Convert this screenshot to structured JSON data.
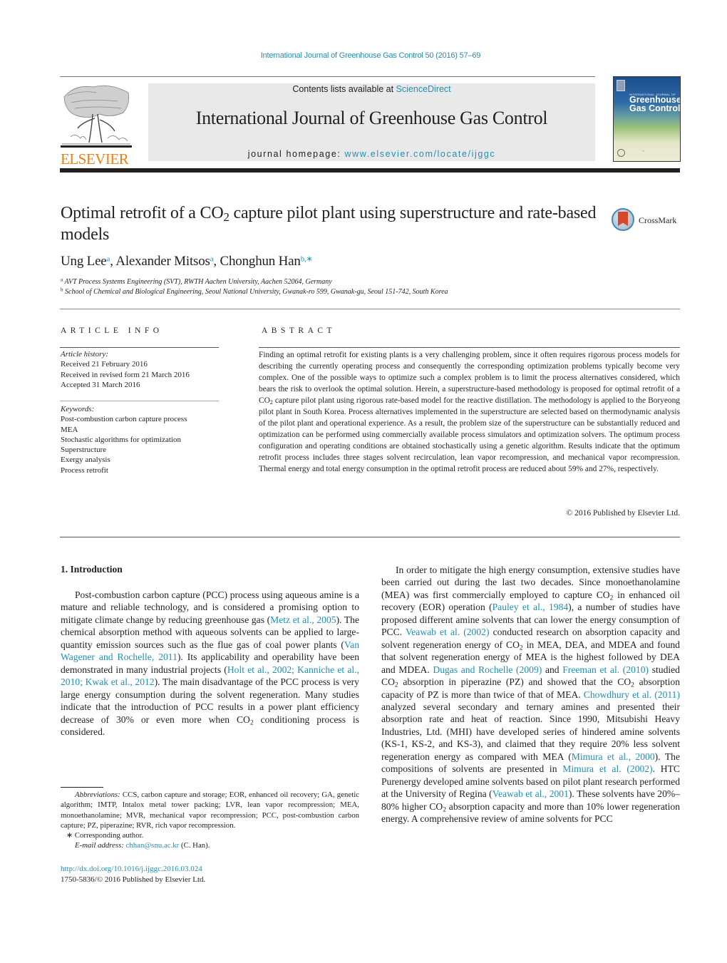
{
  "running_head": "International Journal of Greenhouse Gas Control 50 (2016) 57–69",
  "header": {
    "publisher_logo": "ELSEVIER",
    "contents_prefix": "Contents lists available at ",
    "contents_link": "ScienceDirect",
    "journal_title": "International Journal of Greenhouse Gas Control",
    "homepage_prefix": "journal homepage: ",
    "homepage_link": "www.elsevier.com/locate/ijggc",
    "cover": {
      "top_line": "INTERNATIONAL JOURNAL OF",
      "title_line1": "Greenhouse",
      "title_line2": "Gas Control"
    }
  },
  "article": {
    "title_part1": "Optimal retrofit of a CO",
    "title_sub": "2",
    "title_part2": " capture pilot plant using superstructure and rate-based models",
    "crossmark_label": "CrossMark",
    "authors": [
      {
        "name": "Ung Lee",
        "sup": "a"
      },
      {
        "name": "Alexander Mitsos",
        "sup": "a"
      },
      {
        "name": "Chonghun Han",
        "sup": "b,∗"
      }
    ],
    "affiliations": [
      {
        "key": "a",
        "text": "AVT Process Systems Engineering (SVT), RWTH Aachen University, Aachen 52064, Germany"
      },
      {
        "key": "b",
        "text": "School of Chemical and Biological Engineering, Seoul National University, Gwanak-ro 599, Gwanak-gu, Seoul 151-742, South Korea"
      }
    ]
  },
  "article_info": {
    "heading": "ARTICLE INFO",
    "history_label": "Article history:",
    "history": [
      "Received 21 February 2016",
      "Received in revised form 21 March 2016",
      "Accepted 31 March 2016"
    ],
    "keywords_label": "Keywords:",
    "keywords": [
      "Post-combustion carbon capture process",
      "MEA",
      "Stochastic algorithms for optimization",
      "Superstructure",
      "Exergy analysis",
      "Process retrofit"
    ]
  },
  "abstract": {
    "heading": "ABSTRACT",
    "text_part1": "Finding an optimal retrofit for existing plants is a very challenging problem, since it often requires rigorous process models for describing the currently operating process and consequently the corresponding optimization problems typically become very complex. One of the possible ways to optimize such a complex problem is to limit the process alternatives considered, which bears the risk to overlook the optimal solution. Herein, a superstructure-based methodology is proposed for optimal retrofit of a CO",
    "text_sub": "2",
    "text_part2": " capture pilot plant using rigorous rate-based model for the reactive distillation. The methodology is applied to the Boryeong pilot plant in South Korea. Process alternatives implemented in the superstructure are selected based on thermodynamic analysis of the pilot plant and operational experience. As a result, the problem size of the superstructure can be substantially reduced and optimization can be performed using commercially available process simulators and optimization solvers. The optimum process configuration and operating conditions are obtained stochastically using a genetic algorithm. Results indicate that the optimum retrofit process includes three stages solvent recirculation, lean vapor recompression, and mechanical vapor recompression. Thermal energy and total energy consumption in the optimal retrofit process are reduced about 59% and 27%, respectively.",
    "copyright": "© 2016 Published by Elsevier Ltd."
  },
  "introduction": {
    "heading": "1.  Introduction",
    "left": {
      "s1": "Post-combustion carbon capture (PCC) process using aqueous amine is a mature and reliable technology, and is considered a promising option to mitigate climate change by reducing greenhouse gas (",
      "c1": "Metz et al., 2005",
      "s2": "). The chemical absorption method with aqueous solvents can be applied to large-quantity emission sources such as the flue gas of coal power plants (",
      "c2": "Van Wagener and Rochelle, 2011",
      "s3": "). Its applicability and operability have been demonstrated in many industrial projects (",
      "c3": "Holt et al., 2002; Kanniche et al., 2010; Kwak et al., 2012",
      "s4": "). The main disadvantage of the PCC process is very large energy consumption during the solvent regeneration. Many studies indicate that the introduction of PCC results in a power plant efficiency decrease of 30% or even more when CO",
      "sub": "2",
      "s5": " conditioning process is considered."
    },
    "right": {
      "s1": "In order to mitigate the high energy consumption, extensive studies have been carried out during the last two decades. Since monoethanolamine (MEA) was first commercially employed to capture CO",
      "sub1": "2",
      "s2": " in enhanced oil recovery (EOR) operation (",
      "c1": "Pauley et al., 1984",
      "s3": "), a number of studies have proposed different amine solvents that can lower the energy consumption of PCC. ",
      "c2": "Veawab et al. (2002)",
      "s4": " conducted research on absorption capacity and solvent regeneration energy of CO",
      "sub2": "2",
      "s5": " in MEA, DEA, and MDEA and found that solvent regeneration energy of MEA is the highest followed by DEA and MDEA. ",
      "c3": "Dugas and Rochelle (2009)",
      "s6": " and ",
      "c4": "Freeman et al. (2010)",
      "s7": " studied CO",
      "sub3": "2",
      "s8": " absorption in piperazine (PZ) and showed that the CO",
      "sub4": "2",
      "s9": " absorption capacity of PZ is more than twice of that of MEA. ",
      "c5": "Chowdhury et al. (2011)",
      "s10": " analyzed several secondary and ternary amines and presented their absorption rate and heat of reaction. Since 1990, Mitsubishi Heavy Industries, Ltd. (MHI) have developed series of hindered amine solvents (KS-1, KS-2, and KS-3), and claimed that they require 20% less solvent regeneration energy as compared with MEA (",
      "c6": "Mimura et al., 2000",
      "s11": "). The compositions of solvents are presented in ",
      "c7": "Mimura et al. (2002)",
      "s12": ". HTC Purenergy developed amine solvents based on pilot plant research performed at the University of Regina (",
      "c8": "Veawab et al., 2001",
      "s13": "). These solvents have 20%–80% higher CO",
      "sub5": "2",
      "s14": " absorption capacity and more than 10% lower regeneration energy. A comprehensive review of amine solvents for PCC"
    }
  },
  "footnotes": {
    "abbrev_label": "Abbreviations:",
    "abbrev_text": " CCS, carbon capture and storage; EOR, enhanced oil recovery; GA, genetic algorithm; IMTP, Intalox metal tower packing; LVR, lean vapor recompression; MEA, monoethanolamine; MVR, mechanical vapor recompression; PCC, post-combustion carbon capture; PZ, piperazine; RVR, rich vapor recompression.",
    "corresponding": "∗  Corresponding author.",
    "email_label": "E-mail address:",
    "email": "chhan@snu.ac.kr",
    "email_suffix": " (C. Han).",
    "doi": "http://dx.doi.org/10.1016/j.ijggc.2016.03.024",
    "issn": "1750-5836/© 2016 Published by Elsevier Ltd."
  },
  "colors": {
    "link": "#1f8fb8",
    "elsevier_orange": "#f07d12",
    "banner_gray": "#e9e9ea",
    "text": "#231f20"
  }
}
